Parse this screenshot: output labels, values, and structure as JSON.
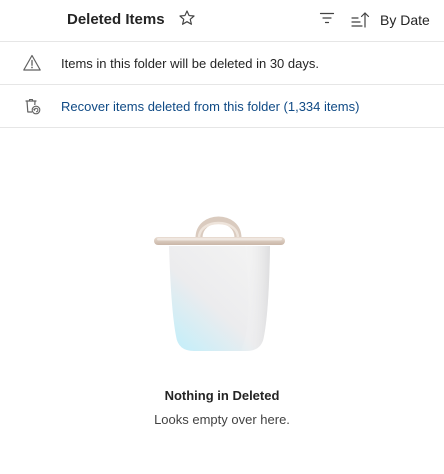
{
  "header": {
    "title": "Deleted Items",
    "favorite_icon": "star-outline-icon",
    "filter_icon": "filter-icon",
    "sort_icon": "sort-ascending-icon",
    "sort_label": "By Date"
  },
  "notices": {
    "warning": {
      "icon": "warning-triangle-icon",
      "text": "Items in this folder will be deleted in 30 days."
    },
    "recover": {
      "icon": "recycle-bin-restore-icon",
      "text": "Recover items deleted from this folder (1,334 items)",
      "color": "#0f4a85"
    }
  },
  "empty_state": {
    "illustration": "empty-trash-bin",
    "title": "Nothing in Deleted",
    "subtitle": "Looks empty over here."
  }
}
